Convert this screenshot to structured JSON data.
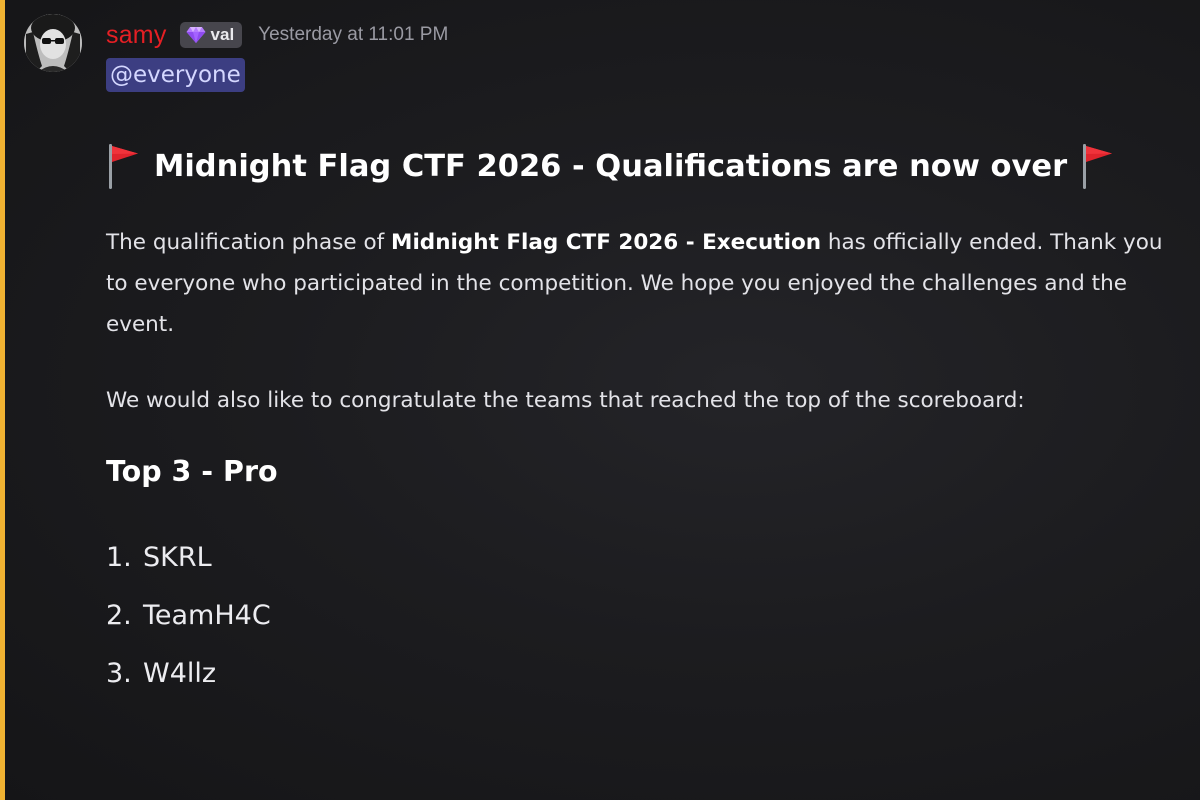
{
  "colors": {
    "background": "#1c1c1f",
    "accent_bar": "#f0b232",
    "username": "#e51f24",
    "mention_bg": "#3c3e82",
    "mention_text": "#d4d7ff",
    "tag_bg": "#47464d",
    "timestamp": "#9a9aa3"
  },
  "message": {
    "author": {
      "username": "samy",
      "avatar_icon": "avatar-photo",
      "tag": {
        "icon": "diamond-gem-icon",
        "label": "val"
      }
    },
    "timestamp": "Yesterday at 11:01 PM",
    "mention": "@everyone",
    "title": {
      "flag_icon": "red-triangular-flag-emoji",
      "text": "Midnight Flag CTF 2026 - Qualifications are now over"
    },
    "paragraph1": {
      "before": "The qualification phase of ",
      "bold": "Midnight Flag CTF 2026 - Execution",
      "after": " has officially ended. Thank you to everyone who participated in the competition. We hope you enjoyed the challenges and the event."
    },
    "paragraph2": "We would also like to congratulate the teams that reached the top of the scoreboard:",
    "section_heading": "Top 3 - Pro",
    "ranking": [
      {
        "number": "1.",
        "team": "SKRL"
      },
      {
        "number": "2.",
        "team": "TeamH4C"
      },
      {
        "number": "3.",
        "team": "W4llz"
      }
    ]
  }
}
